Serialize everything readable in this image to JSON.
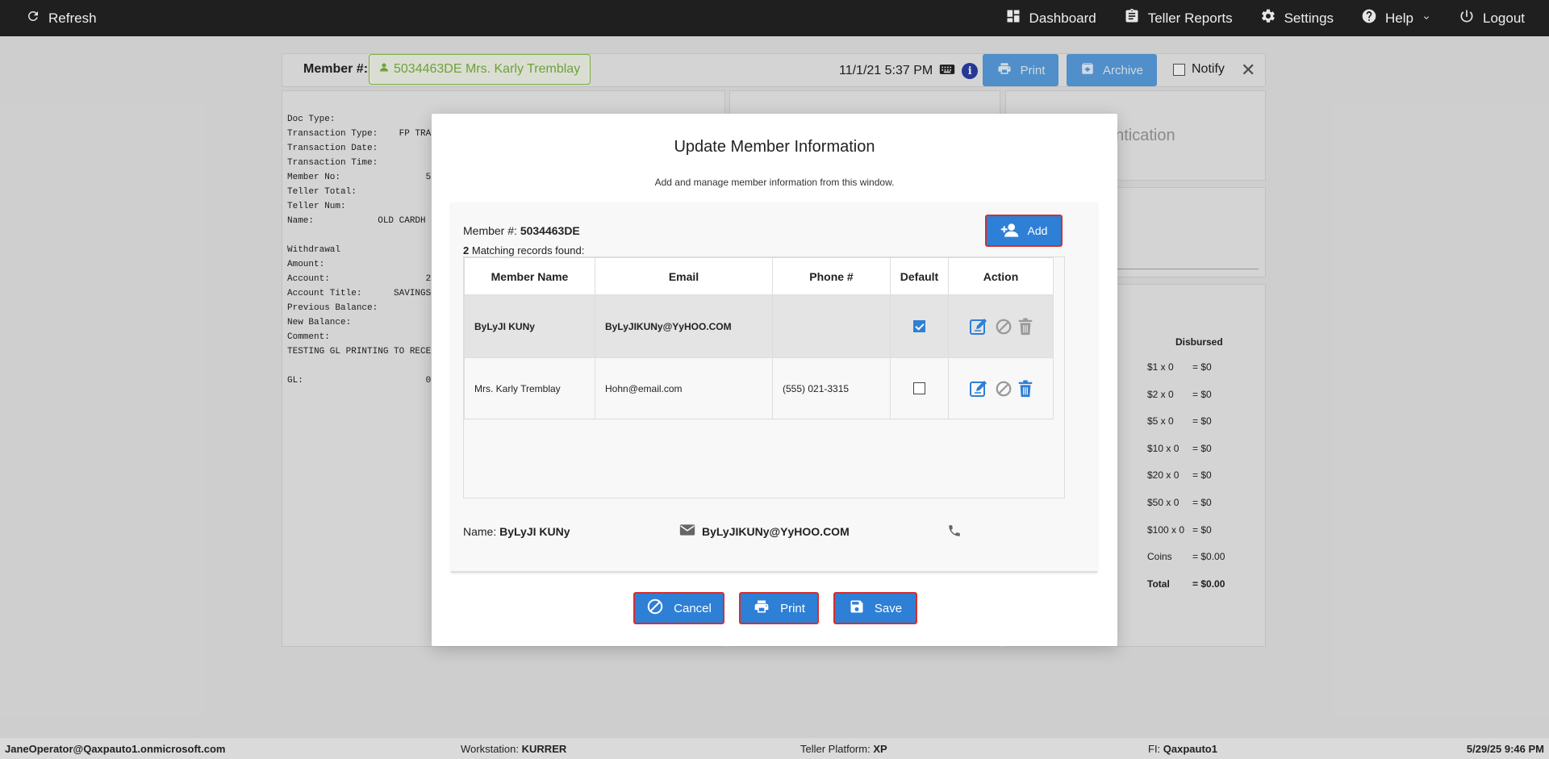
{
  "topnav": {
    "refresh": "Refresh",
    "dashboard": "Dashboard",
    "teller_reports": "Teller Reports",
    "settings": "Settings",
    "help": "Help",
    "logout": "Logout"
  },
  "background": {
    "member_label": "Member #:",
    "member_chip": "5034463DE Mrs. Karly Tremblay",
    "datetime": "11/1/21 5:37 PM",
    "print": "Print",
    "archive": "Archive",
    "notify": "Notify",
    "receipt_text": "Doc Type:\nTransaction Type:    FP TRA\nTransaction Date:\nTransaction Time:\nMember No:                5\nTeller Total:\nTeller Num:\nName:            OLD CARDH\n\nWithdrawal\nAmount:\nAccount:                  2\nAccount Title:      SAVINGS\nPrevious Balance:\nNew Balance:\nComment:\nTESTING GL PRINTING TO RECE\n\nGL:                       0",
    "auth_fragment": "entication",
    "disbursed_title": "Disbursed",
    "disbursed_rows": [
      {
        "denom": "$1 x 0",
        "total": "= $0"
      },
      {
        "denom": "$2 x 0",
        "total": "= $0"
      },
      {
        "denom": "$5 x 0",
        "total": "= $0"
      },
      {
        "denom": "$10 x 0",
        "total": "= $0"
      },
      {
        "denom": "$20 x 0",
        "total": "= $0"
      },
      {
        "denom": "$50 x 0",
        "total": "= $0"
      },
      {
        "denom": "$100 x 0",
        "total": "= $0"
      },
      {
        "denom": "Coins",
        "total": "= $0.00"
      },
      {
        "denom": "Total",
        "total": "= $0.00"
      }
    ]
  },
  "modal": {
    "title": "Update Member Information",
    "subtitle": "Add and manage member information from this window.",
    "member_label": "Member #:",
    "member_number": "5034463DE",
    "match_count": "2",
    "match_text": "Matching records found:",
    "add_label": "Add",
    "columns": [
      "Member Name",
      "Email",
      "Phone #",
      "Default",
      "Action"
    ],
    "rows": [
      {
        "name": "ByLyJI KUNy",
        "email": "ByLyJIKUNy@YyHOO.COM",
        "phone": "",
        "default": true
      },
      {
        "name": "Mrs. Karly Tremblay",
        "email": "Hohn@email.com",
        "phone": "(555) 021-3315",
        "default": false
      }
    ],
    "footer_name_label": "Name:",
    "footer_name": "ByLyJI KUNy",
    "footer_email": "ByLyJIKUNy@YyHOO.COM",
    "cancel_label": "Cancel",
    "print_label": "Print",
    "save_label": "Save"
  },
  "statusbar": {
    "user": "JaneOperator@Qaxpauto1.onmicrosoft.com",
    "workstation_label": "Workstation:",
    "workstation": "KURRER",
    "platform_label": "Teller Platform:",
    "platform": "XP",
    "fi_label": "FI:",
    "fi": "Qaxpauto1",
    "datetime": "5/29/25 9:46 PM"
  },
  "colors": {
    "accent": "#2e7fd6",
    "highlight_border": "#d32f2f",
    "nav_bg": "#1f1f1f",
    "member_chip": "#7cb342"
  }
}
